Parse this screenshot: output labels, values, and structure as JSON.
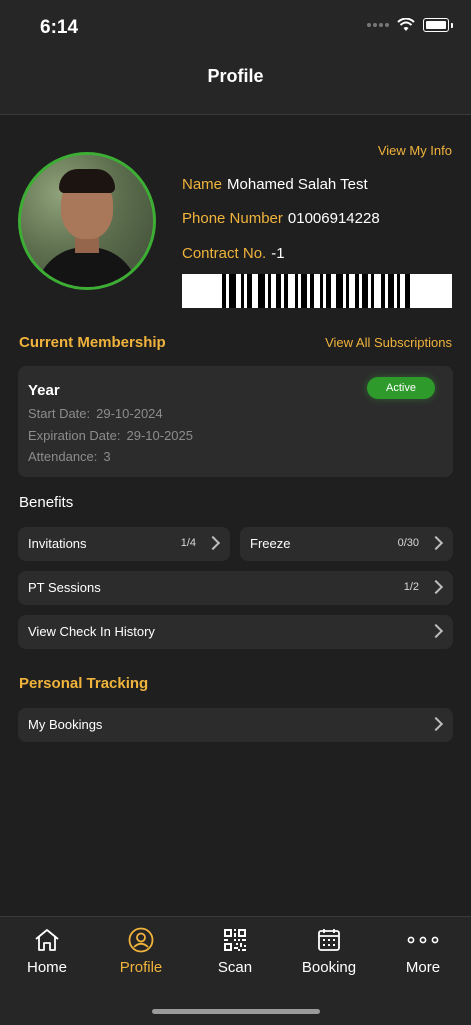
{
  "status_bar": {
    "time": "6:14"
  },
  "header": {
    "title": "Profile"
  },
  "profile": {
    "view_info_label": "View My Info",
    "name_label": "Name",
    "name_value": "Mohamed Salah Test",
    "phone_label": "Phone Number",
    "phone_value": "01006914228",
    "contract_label": "Contract No.",
    "contract_value": "-1"
  },
  "membership": {
    "section_title": "Current Membership",
    "view_all_label": "View All Subscriptions",
    "plan": "Year",
    "status": "Active",
    "start_label": "Start Date:",
    "start_value": "29-10-2024",
    "expiration_label": "Expiration Date:",
    "expiration_value": "29-10-2025",
    "attendance_label": "Attendance:",
    "attendance_value": "3"
  },
  "benefits": {
    "title": "Benefits",
    "invitations_label": "Invitations",
    "invitations_count": "1/4",
    "freeze_label": "Freeze",
    "freeze_count": "0/30",
    "pt_label": "PT Sessions",
    "pt_count": "1/2",
    "checkin_label": "View Check In History"
  },
  "tracking": {
    "title": "Personal Tracking",
    "bookings_label": "My Bookings"
  },
  "tabs": [
    {
      "label": "Home",
      "icon": "home-icon"
    },
    {
      "label": "Profile",
      "icon": "user-circle-icon",
      "active": true
    },
    {
      "label": "Scan",
      "icon": "qr-code-icon"
    },
    {
      "label": "Booking",
      "icon": "calendar-icon"
    },
    {
      "label": "More",
      "icon": "more-dots-icon"
    }
  ],
  "colors": {
    "accent": "#f0b33c",
    "active_green": "#2e9a2b",
    "background": "#1f1f1f",
    "card": "#2c2c2c"
  }
}
